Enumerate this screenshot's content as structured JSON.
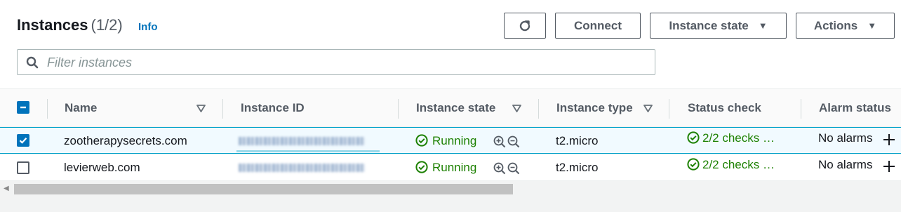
{
  "header": {
    "title": "Instances",
    "count": "(1/2)",
    "info_link": "Info"
  },
  "toolbar": {
    "refresh_icon": "refresh-icon",
    "connect_label": "Connect",
    "instance_state_label": "Instance state",
    "actions_label": "Actions"
  },
  "search": {
    "placeholder": "Filter instances",
    "value": ""
  },
  "table": {
    "columns": {
      "name": "Name",
      "instance_id": "Instance ID",
      "instance_state": "Instance state",
      "instance_type": "Instance type",
      "status_check": "Status check",
      "alarm_status": "Alarm status"
    },
    "rows": [
      {
        "selected": true,
        "name": "zootherapysecrets.com",
        "state": "Running",
        "type": "t2.micro",
        "status_check": "2/2 checks …",
        "alarm": "No alarms"
      },
      {
        "selected": false,
        "name": "levierweb.com",
        "state": "Running",
        "type": "t2.micro",
        "status_check": "2/2 checks …",
        "alarm": "No alarms"
      }
    ]
  },
  "colors": {
    "link": "#0073bb",
    "success": "#1d8102",
    "selected_border": "#00a1c9"
  }
}
